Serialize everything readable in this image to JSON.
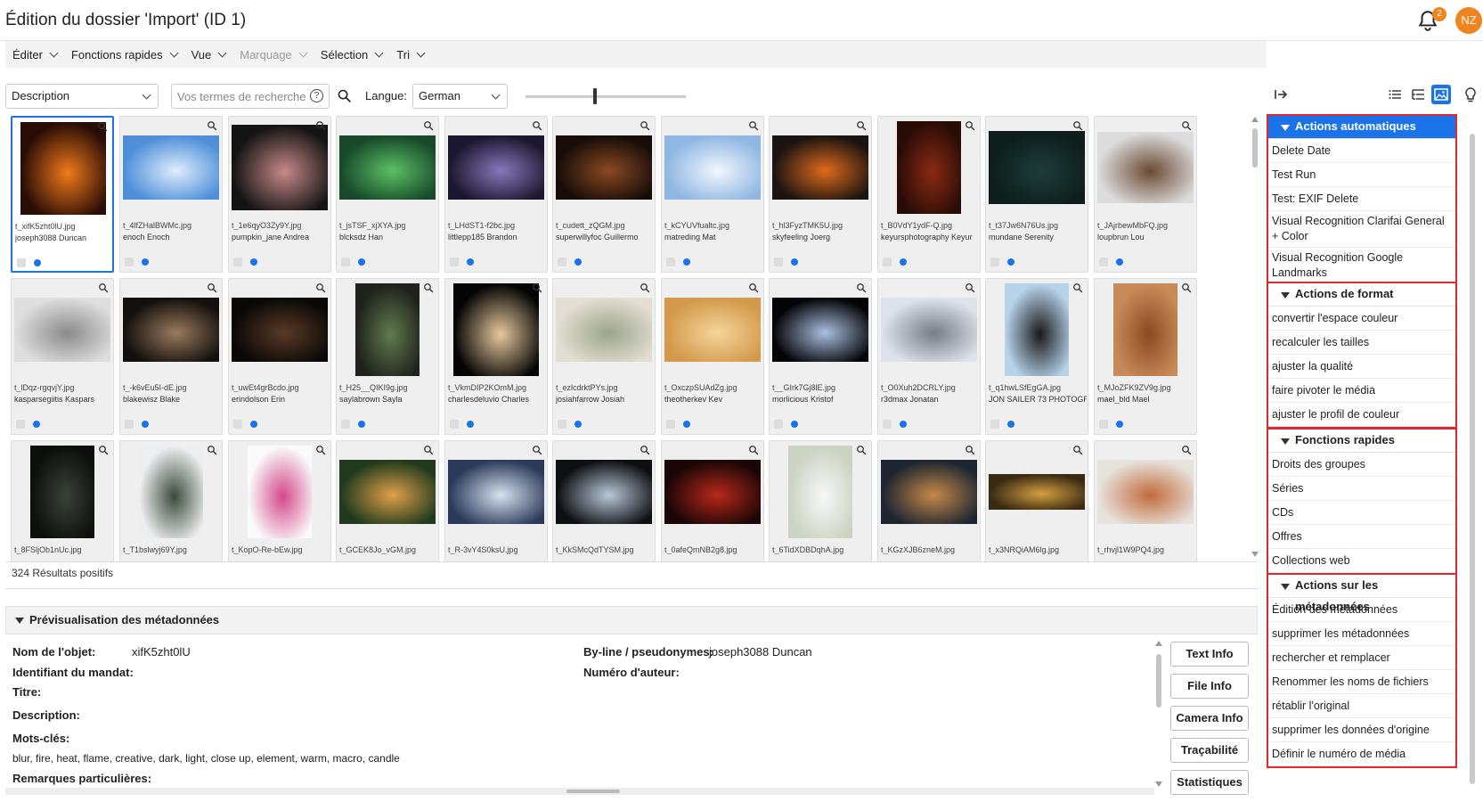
{
  "header": {
    "title": "Édition du dossier 'Import' (ID 1)",
    "notification_count": "2",
    "avatar_initials": "NZ"
  },
  "menubar": [
    {
      "label": "Éditer",
      "disabled": false
    },
    {
      "label": "Fonctions rapides",
      "disabled": false
    },
    {
      "label": "Vue",
      "disabled": false
    },
    {
      "label": "Marquage",
      "disabled": true
    },
    {
      "label": "Sélection",
      "disabled": false
    },
    {
      "label": "Tri",
      "disabled": false
    }
  ],
  "search": {
    "field_select": "Description",
    "placeholder": "Vos termes de recherche",
    "help_glyph": "?",
    "language_label": "Langue:",
    "language_value": "German"
  },
  "grid": {
    "items": [
      {
        "file": "t_xifK5zht0lU.jpg",
        "author": "joseph3088 Duncan",
        "color": "#2a0d05",
        "accent": "#f07a1a",
        "w": 96,
        "h": 104,
        "selected": true
      },
      {
        "file": "t_4lfZHalBWMc.jpg",
        "author": "enoch Enoch",
        "color": "#4f8fd9",
        "accent": "#dfeefc",
        "w": 108,
        "h": 72
      },
      {
        "file": "t_1e6qyO3Zy9Y.jpg",
        "author": "pumpkin_jane Andrea",
        "color": "#141414",
        "accent": "#c98989",
        "w": 108,
        "h": 96
      },
      {
        "file": "t_jsTSF_xjXYA.jpg",
        "author": "blcksdz Han",
        "color": "#17492a",
        "accent": "#5cc065",
        "w": 108,
        "h": 72
      },
      {
        "file": "t_LHdST1-f2bc.jpg",
        "author": "littlepp185 Brandon",
        "color": "#1c1730",
        "accent": "#8878bb",
        "w": 108,
        "h": 72
      },
      {
        "file": "t_cudett_zQGM.jpg",
        "author": "superwillyfoc Guillermo",
        "color": "#170c08",
        "accent": "#8a4a22",
        "w": 108,
        "h": 72
      },
      {
        "file": "t_kCYUVfualtc.jpg",
        "author": "matreding Mat",
        "color": "#8fb7e3",
        "accent": "#f2f7fd",
        "w": 108,
        "h": 72
      },
      {
        "file": "t_hl3FyzTMK5U.jpg",
        "author": "skyfeeling Joerg",
        "color": "#1b1410",
        "accent": "#e06a1c",
        "w": 108,
        "h": 72
      },
      {
        "file": "t_B0VdY1ydF-Q.jpg",
        "author": "keyursphotography Keyur",
        "color": "#2a0c06",
        "accent": "#8a2a12",
        "w": 72,
        "h": 104
      },
      {
        "file": "t_t37Jw6N76Us.jpg",
        "author": "mundane Serenity",
        "color": "#0c1d1b",
        "accent": "#1e3d3a",
        "w": 108,
        "h": 82
      },
      {
        "file": "t_JAjrbewMbFQ.jpg",
        "author": "loupbrun Lou",
        "color": "#dcdcdc",
        "accent": "#6b4a33",
        "w": 108,
        "h": 80
      },
      {
        "file": "t_lDqz-rgqvjY.jpg",
        "author": "kasparsegiitis Kaspars",
        "color": "#dedede",
        "accent": "#8a8a8a",
        "w": 108,
        "h": 72
      },
      {
        "file": "t_-k6vEu5I-dE.jpg",
        "author": "blakewisz Blake",
        "color": "#14100d",
        "accent": "#9a7a5e",
        "w": 108,
        "h": 72
      },
      {
        "file": "t_uwEt4grBcdo.jpg",
        "author": "erindolson Erin",
        "color": "#0a0807",
        "accent": "#5a3a26",
        "w": 108,
        "h": 72
      },
      {
        "file": "t_H25__QIKI9g.jpg",
        "author": "saylabrown Sayla",
        "color": "#1f231c",
        "accent": "#627a4f",
        "w": 72,
        "h": 104
      },
      {
        "file": "t_VkmDIP2KOmM.jpg",
        "author": "charlesdeluvio Charles",
        "color": "#050505",
        "accent": "#e8c99e",
        "w": 96,
        "h": 104
      },
      {
        "file": "t_ezlcdrktPYs.jpg",
        "author": "josiahfarrow Josiah",
        "color": "#e3ddd2",
        "accent": "#9aa58a",
        "w": 108,
        "h": 72
      },
      {
        "file": "t_OxczpSUAdZg.jpg",
        "author": "theotherkev Kev",
        "color": "#d39a4c",
        "accent": "#f5d59a",
        "w": 108,
        "h": 72
      },
      {
        "file": "t__GIrk7Gj8lE.jpg",
        "author": "morlicious Kristof",
        "color": "#050508",
        "accent": "#aac0e0",
        "w": 108,
        "h": 72
      },
      {
        "file": "t_O0Xuh2DCRLY.jpg",
        "author": "r3dmax Jonatan",
        "color": "#dde3ea",
        "accent": "#777d85",
        "w": 108,
        "h": 72
      },
      {
        "file": "t_q1hwLSfEgGA.jpg",
        "author": "JON SAILER 73 PHOTOGR",
        "color": "#b7d3ea",
        "accent": "#191919",
        "w": 72,
        "h": 104
      },
      {
        "file": "t_MJoZFK9ZV9g.jpg",
        "author": "mael_bld Mael",
        "color": "#c98a5a",
        "accent": "#8a4a22",
        "w": 72,
        "h": 104
      },
      {
        "file": "t_8FSljOb1nUc.jpg",
        "author": "",
        "color": "#0d0f0d",
        "accent": "#394238",
        "w": 72,
        "h": 104
      },
      {
        "file": "t_T1bslwyj69Y.jpg",
        "author": "",
        "color": "#eceeef",
        "accent": "#3b4a3c",
        "w": 72,
        "h": 104
      },
      {
        "file": "t_KopO-Re-bEw.jpg",
        "author": "",
        "color": "#fafafa",
        "accent": "#d4488a",
        "w": 72,
        "h": 104
      },
      {
        "file": "t_GCEK8Jo_vGM.jpg",
        "author": "",
        "color": "#1f3a1c",
        "accent": "#e0a04a",
        "w": 108,
        "h": 72
      },
      {
        "file": "t_R-3vY4S0ksU.jpg",
        "author": "",
        "color": "#2a3a5a",
        "accent": "#d8e2ef",
        "w": 108,
        "h": 72
      },
      {
        "file": "t_KkSMcQdTYSM.jpg",
        "author": "",
        "color": "#0e0f12",
        "accent": "#b9c9d9",
        "w": 108,
        "h": 72
      },
      {
        "file": "t_0afeQmNB2g8.jpg",
        "author": "",
        "color": "#1a0606",
        "accent": "#b8281a",
        "w": 108,
        "h": 72
      },
      {
        "file": "t_6TidXDBDqhA.jpg",
        "author": "",
        "color": "#cbd3c2",
        "accent": "#f8f8f8",
        "w": 72,
        "h": 104
      },
      {
        "file": "t_KGzXJB6zneM.jpg",
        "author": "",
        "color": "#1d2530",
        "accent": "#c58a4a",
        "w": 108,
        "h": 72
      },
      {
        "file": "t_x3NRQiAM6lg.jpg",
        "author": "",
        "color": "#3a2a12",
        "accent": "#d4a040",
        "w": 108,
        "h": 40
      },
      {
        "file": "t_rhvjl1W9PQ4.jpg",
        "author": "",
        "color": "#e6e2dc",
        "accent": "#c26a3a",
        "w": 108,
        "h": 72
      }
    ]
  },
  "results": {
    "count_label": "324 Résultats positifs"
  },
  "metadata": {
    "section_title": "Prévisualisation des métadonnées",
    "object_name_label": "Nom de l'objet:",
    "object_name_value": "xifK5zht0lU",
    "mandate_label": "Identifiant du mandat:",
    "title_label": "Titre:",
    "description_label": "Description:",
    "keywords_label": "Mots-clés:",
    "keywords_value": "blur, fire, heat, flame, creative, dark, light, close up, element, warm, macro, candle",
    "remarks_label": "Remarques particulières:",
    "byline_label": "By-line / pseudonymes:",
    "byline_value": "joseph3088 Duncan",
    "author_number_label": "Numéro d'auteur:",
    "buttons": [
      "Text Info",
      "File Info",
      "Camera Info",
      "Traçabilité",
      "Statistiques"
    ]
  },
  "actions_panel": {
    "sections": [
      {
        "title": "Actions automatiques",
        "active": true,
        "items": [
          "Delete Date",
          "Test Run",
          "Test: EXIF Delete",
          "Visual Recognition Clarifai General + Color",
          "Visual Recognition Google Landmarks"
        ]
      },
      {
        "title": "Actions de format",
        "active": false,
        "items": [
          "convertir l'espace couleur",
          "recalculer les tailles",
          "ajuster la qualité",
          "faire pivoter le média",
          "ajuster le profil de couleur"
        ]
      },
      {
        "title": "Fonctions rapides",
        "active": false,
        "items": [
          "Droits des groupes",
          "Séries",
          "CDs",
          "Offres",
          "Collections web"
        ]
      },
      {
        "title": "Actions sur les métadonnées",
        "active": false,
        "items": [
          "Édition des métadonnées",
          "supprimer les métadonnées",
          "rechercher et remplacer",
          "Renommer les noms de fichiers",
          "rétablir l'original",
          "supprimer les données d'origine",
          "Définir le numéro de média"
        ]
      }
    ]
  },
  "colors": {
    "accent": "#1a73e8",
    "highlight_border": "#e3262f",
    "badge": "#f0841e"
  }
}
